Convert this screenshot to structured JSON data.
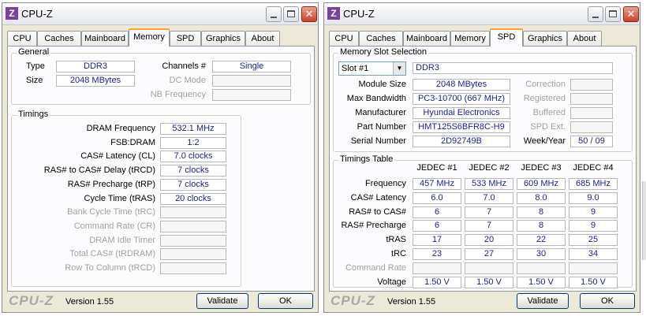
{
  "app": {
    "title": "CPU-Z",
    "icon_letter": "Z",
    "logo": "CPU-Z",
    "version": "Version 1.55",
    "validate_label": "Validate",
    "ok_label": "OK",
    "close_glyph": "✕",
    "tabs": [
      "CPU",
      "Caches",
      "Mainboard",
      "Memory",
      "SPD",
      "Graphics",
      "About"
    ]
  },
  "memory": {
    "general_title": "General",
    "type_label": "Type",
    "type": "DDR3",
    "size_label": "Size",
    "size": "2048 MBytes",
    "channels_label": "Channels #",
    "channels": "Single",
    "dc_mode_label": "DC Mode",
    "nb_frequency_label": "NB Frequency",
    "timings_title": "Timings",
    "rows": [
      {
        "label": "DRAM Frequency",
        "value": "532.1 MHz",
        "dim": false
      },
      {
        "label": "FSB:DRAM",
        "value": "1:2",
        "dim": false
      },
      {
        "label": "CAS# Latency (CL)",
        "value": "7.0 clocks",
        "dim": false
      },
      {
        "label": "RAS# to CAS# Delay (tRCD)",
        "value": "7 clocks",
        "dim": false
      },
      {
        "label": "RAS# Precharge (tRP)",
        "value": "7 clocks",
        "dim": false
      },
      {
        "label": "Cycle Time (tRAS)",
        "value": "20 clocks",
        "dim": false
      },
      {
        "label": "Bank Cycle Time (tRC)",
        "value": "",
        "dim": true
      },
      {
        "label": "Command Rate (CR)",
        "value": "",
        "dim": true
      },
      {
        "label": "DRAM Idle Timer",
        "value": "",
        "dim": true
      },
      {
        "label": "Total CAS# (tRDRAM)",
        "value": "",
        "dim": true
      },
      {
        "label": "Row To Column (tRCD)",
        "value": "",
        "dim": true
      }
    ]
  },
  "spd": {
    "slot_group_title": "Memory Slot Selection",
    "slot": "Slot #1",
    "slot_type": "DDR3",
    "module_size_label": "Module Size",
    "module_size": "2048 MBytes",
    "max_bandwidth_label": "Max Bandwidth",
    "max_bandwidth": "PC3-10700 (667 MHz)",
    "manufacturer_label": "Manufacturer",
    "manufacturer": "Hyundai Electronics",
    "part_number_label": "Part Number",
    "part_number": "HMT125S6BFR8C-H9",
    "serial_number_label": "Serial Number",
    "serial_number": "2D92749B",
    "correction_label": "Correction",
    "registered_label": "Registered",
    "buffered_label": "Buffered",
    "spd_ext_label": "SPD Ext.",
    "week_year_label": "Week/Year",
    "week_year": "50 / 09",
    "timings_table_title": "Timings Table",
    "columns": [
      "JEDEC #1",
      "JEDEC #2",
      "JEDEC #3",
      "JEDEC #4"
    ],
    "rows": [
      {
        "label": "Frequency",
        "values": [
          "457 MHz",
          "533 MHz",
          "609 MHz",
          "685 MHz"
        ],
        "dim": false
      },
      {
        "label": "CAS# Latency",
        "values": [
          "6.0",
          "7.0",
          "8.0",
          "9.0"
        ],
        "dim": false
      },
      {
        "label": "RAS# to CAS#",
        "values": [
          "6",
          "7",
          "8",
          "9"
        ],
        "dim": false
      },
      {
        "label": "RAS# Precharge",
        "values": [
          "6",
          "7",
          "8",
          "9"
        ],
        "dim": false
      },
      {
        "label": "tRAS",
        "values": [
          "17",
          "20",
          "22",
          "25"
        ],
        "dim": false
      },
      {
        "label": "tRC",
        "values": [
          "23",
          "27",
          "30",
          "34"
        ],
        "dim": false
      },
      {
        "label": "Command Rate",
        "values": [
          "",
          "",
          "",
          ""
        ],
        "dim": true
      },
      {
        "label": "Voltage",
        "values": [
          "1.50 V",
          "1.50 V",
          "1.50 V",
          "1.50 V"
        ],
        "dim": false
      }
    ]
  }
}
